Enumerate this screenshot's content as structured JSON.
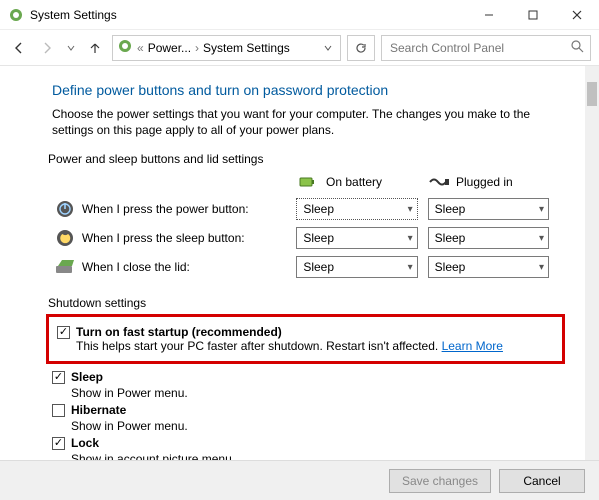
{
  "window": {
    "title": "System Settings"
  },
  "breadcrumb": {
    "item1": "Power...",
    "item2": "System Settings"
  },
  "search": {
    "placeholder": "Search Control Panel"
  },
  "page": {
    "heading": "Define power buttons and turn on password protection",
    "description": "Choose the power settings that you want for your computer. The changes you make to the settings on this page apply to all of your power plans."
  },
  "sections": {
    "buttons_header": "Power and sleep buttons and lid settings",
    "shutdown_header": "Shutdown settings"
  },
  "cols": {
    "battery": "On battery",
    "plugged": "Plugged in"
  },
  "rows": {
    "power": {
      "label": "When I press the power button:",
      "battery": "Sleep",
      "plugged": "Sleep"
    },
    "sleep": {
      "label": "When I press the sleep button:",
      "battery": "Sleep",
      "plugged": "Sleep"
    },
    "lid": {
      "label": "When I close the lid:",
      "battery": "Sleep",
      "plugged": "Sleep"
    }
  },
  "shutdown": {
    "fast_startup": {
      "label": "Turn on fast startup (recommended)",
      "desc_prefix": "This helps start your PC faster after shutdown. Restart isn't affected. ",
      "link": "Learn More"
    },
    "sleep": {
      "label": "Sleep",
      "desc": "Show in Power menu."
    },
    "hibernate": {
      "label": "Hibernate",
      "desc": "Show in Power menu."
    },
    "lock": {
      "label": "Lock",
      "desc": "Show in account picture menu."
    }
  },
  "footer": {
    "save": "Save changes",
    "cancel": "Cancel"
  }
}
